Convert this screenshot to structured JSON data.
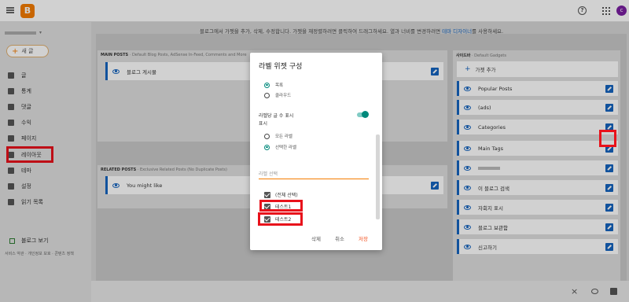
{
  "topbar": {
    "logo_letter": "B",
    "help_glyph": "?",
    "avatar_letter": "c",
    "icons": [
      "hamburger-icon",
      "blogger-logo",
      "help-icon",
      "apps-icon",
      "avatar"
    ]
  },
  "sidebar": {
    "new_button": "새 글",
    "items": [
      {
        "label": "글",
        "icon": "posts-icon"
      },
      {
        "label": "통계",
        "icon": "stats-icon"
      },
      {
        "label": "댓글",
        "icon": "comments-icon"
      },
      {
        "label": "수익",
        "icon": "earnings-icon"
      },
      {
        "label": "페이지",
        "icon": "pages-icon"
      },
      {
        "label": "레이아웃",
        "icon": "layout-icon"
      },
      {
        "label": "테마",
        "icon": "theme-icon"
      },
      {
        "label": "설정",
        "icon": "settings-icon"
      },
      {
        "label": "읽기 목록",
        "icon": "reading-list-icon"
      }
    ],
    "view_blog": "블로그 보기",
    "footer": "서비스 약관 · 개인정보 보호 · 콘텐츠 정책"
  },
  "main": {
    "info_text": "블로그에서 가젯을 추가, 삭제, 수정합니다. 가젯을 재정렬하려면 클릭하여 드래그하세요. 열과 너비를 변경하려면 ",
    "info_link": "테마 디자이너",
    "info_suffix": "를 사용하세요.",
    "main_posts": {
      "title": "MAIN POSTS",
      "subtitle": " · Default Blog Posts, AdSense In-Feed, Comments and More",
      "gadget": "블로그 게시물"
    },
    "related_posts": {
      "title": "RELATED POSTS",
      "subtitle": " · Exclusive Related Posts (No Duplicate Posts)",
      "gadget": "You might like"
    },
    "sidebar_section": {
      "title": "사이드바",
      "subtitle": " · Default Gadgets",
      "add_gadget": "가젯 추가",
      "gadgets": [
        "Popular Posts",
        "(ads)",
        "Categories",
        "Main Tags",
        "",
        "이 블로그 검색",
        "자회지 표시",
        "블로그 보관함",
        "신고하기"
      ]
    }
  },
  "dialog": {
    "title": "라벨 위젯 구성",
    "layout_options": [
      "목록",
      "클라우드"
    ],
    "layout_selected": 0,
    "toggle_label": "라벨당 글 수 표시",
    "show_label": "표시",
    "show_options": [
      "모든 라벨",
      "선택한 라벨"
    ],
    "show_selected": 1,
    "select_placeholder": "라벨 선택",
    "labels": [
      "(전체 선택)",
      "테스트1",
      "테스트2"
    ],
    "buttons": {
      "delete": "삭제",
      "cancel": "취소",
      "save": "저장"
    },
    "accent_color": "#00897b",
    "save_color": "#f4511e"
  },
  "highlight_color": "#e8121b"
}
